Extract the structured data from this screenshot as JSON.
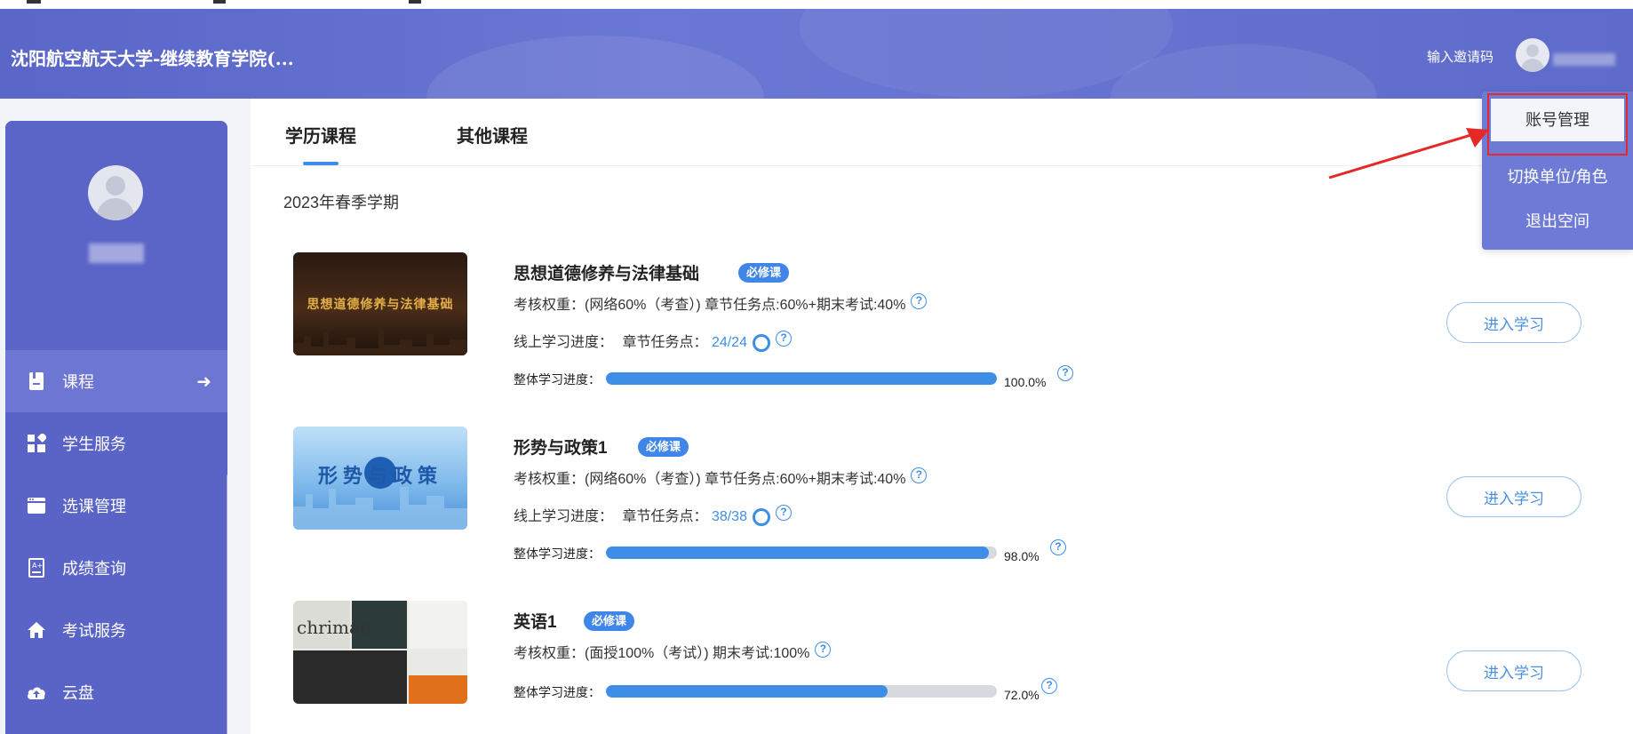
{
  "header": {
    "title": "沈阳航空航天大学-继续教育学院(...",
    "invite_label": "输入邀请码"
  },
  "sidebar": {
    "items": [
      {
        "label": "课程",
        "icon": "book-icon",
        "active": true
      },
      {
        "label": "学生服务",
        "icon": "grid-icon",
        "active": false
      },
      {
        "label": "选课管理",
        "icon": "window-icon",
        "active": false
      },
      {
        "label": "成绩查询",
        "icon": "grade-icon",
        "active": false
      },
      {
        "label": "考试服务",
        "icon": "home-icon",
        "active": false
      },
      {
        "label": "云盘",
        "icon": "cloud-upload-icon",
        "active": false
      }
    ]
  },
  "tabs": [
    {
      "label": "学历课程",
      "active": true
    },
    {
      "label": "其他课程",
      "active": false
    }
  ],
  "semester": "2023年春季学期",
  "courses": [
    {
      "title": "思想道德修养与法律基础",
      "badge": "必修课",
      "weight_label": "考核权重：",
      "weight_text": "(网络60%（考查）) 章节任务点:60%+期末考试:40%",
      "online_label": "线上学习进度：",
      "task_label": "章节任务点：",
      "task_value": "24/24",
      "progress_label": "整体学习进度：",
      "progress": 100.0,
      "progress_text": "100.0%",
      "button": "进入学习",
      "thumb_text": "思想道德修养与法律基础"
    },
    {
      "title": "形势与政策1",
      "badge": "必修课",
      "weight_label": "考核权重：",
      "weight_text": "(网络60%（考查）) 章节任务点:60%+期末考试:40%",
      "online_label": "线上学习进度：",
      "task_label": "章节任务点：",
      "task_value": "38/38",
      "progress_label": "整体学习进度：",
      "progress": 98.0,
      "progress_text": "98.0%",
      "button": "进入学习",
      "thumb_text": "形势与政策"
    },
    {
      "title": "英语1",
      "badge": "必修课",
      "weight_label": "考核权重：",
      "weight_text": "(面授100%（考试）) 期末考试:100%",
      "progress_label": "整体学习进度：",
      "progress": 72.0,
      "progress_text": "72.0%",
      "button": "进入学习",
      "thumb_text": "chrimae"
    }
  ],
  "dropdown": {
    "items": [
      "账号管理",
      "切换单位/角色",
      "退出空间"
    ]
  },
  "help_glyph": "?",
  "colors": {
    "header": "#6672cf",
    "sidebar": "#5a63c6",
    "accent": "#3e8ee8",
    "highlight": "#e52828"
  }
}
